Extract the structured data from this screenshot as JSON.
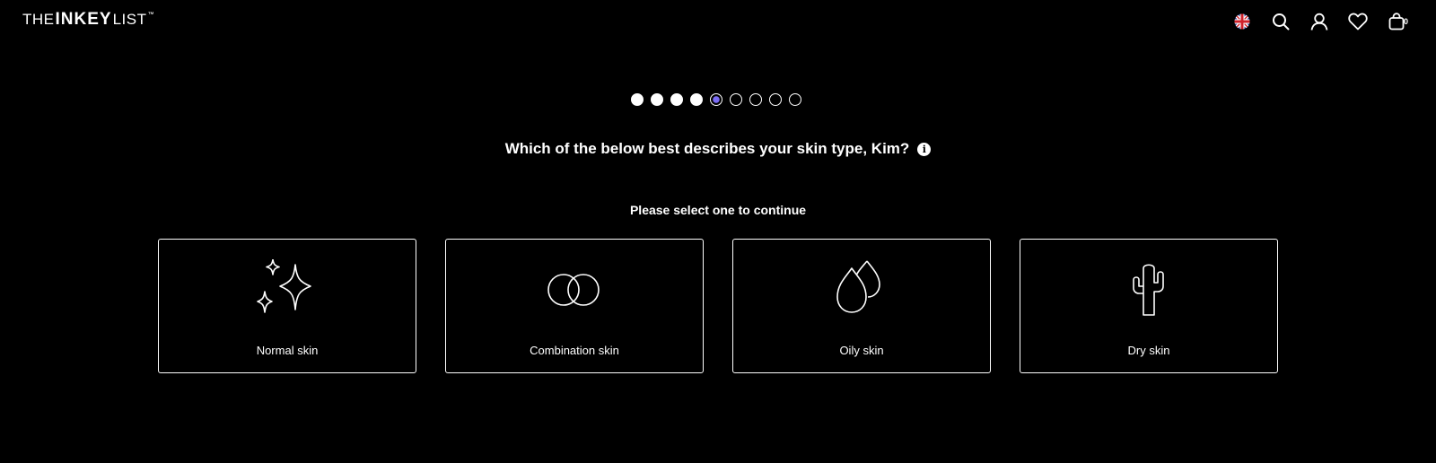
{
  "header": {
    "logo": {
      "the": "THE",
      "inkey": "INKEY",
      "list": "LIST",
      "tm": "™"
    },
    "icons": [
      "uk-flag-icon",
      "search-icon",
      "user-icon",
      "heart-icon",
      "bag-icon"
    ],
    "bag_count": "0"
  },
  "progress": {
    "total_steps": 9,
    "completed_steps": 4,
    "current_step": 5,
    "colors": {
      "done": "#ffffff",
      "current_accent": "#7b6cf5"
    }
  },
  "question": {
    "text": "Which of the below best describes your skin type, Kim?",
    "info_glyph": "i"
  },
  "instruction": "Please select one to continue",
  "options": [
    {
      "label": "Normal skin",
      "icon": "sparkles-icon"
    },
    {
      "label": "Combination skin",
      "icon": "overlapping-circles-icon"
    },
    {
      "label": "Oily skin",
      "icon": "droplets-icon"
    },
    {
      "label": "Dry skin",
      "icon": "cactus-icon"
    }
  ],
  "colors": {
    "background": "#000000",
    "foreground": "#ffffff"
  }
}
